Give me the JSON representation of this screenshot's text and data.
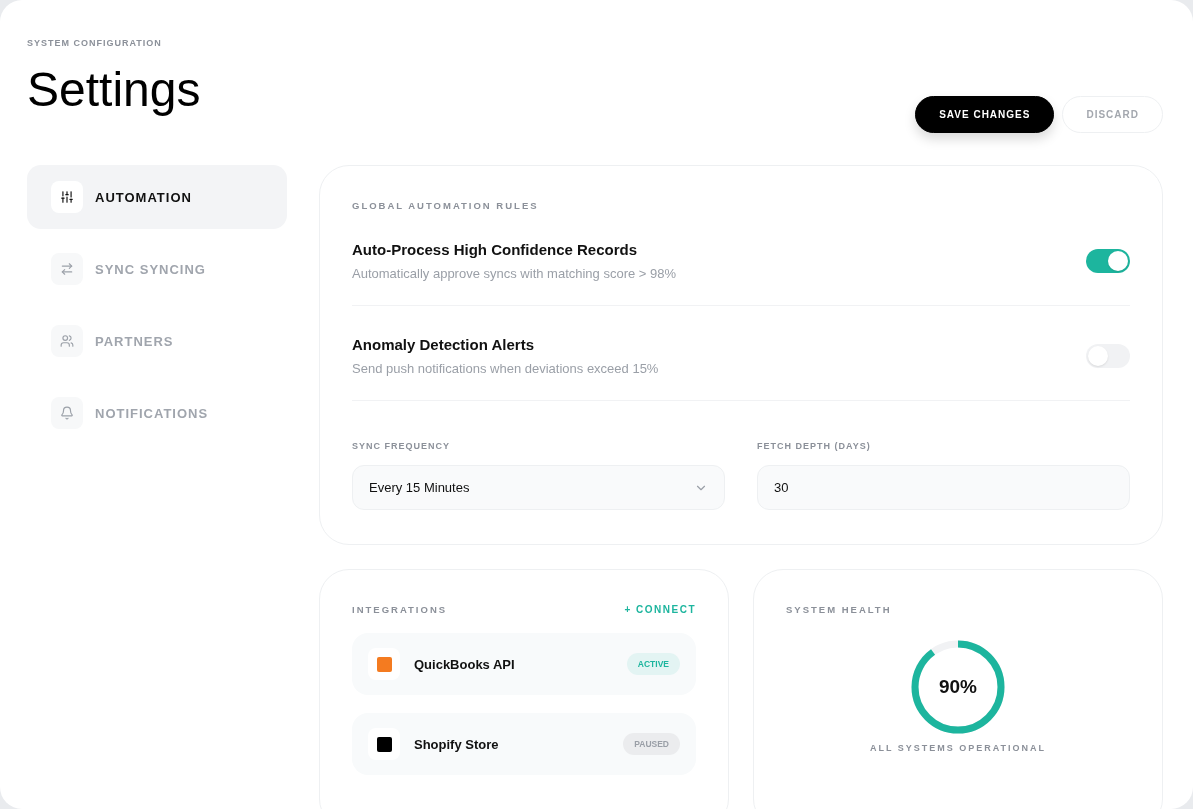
{
  "header": {
    "eyebrow": "SYSTEM CONFIGURATION",
    "title": "Settings",
    "buttons": [
      {
        "label": "SAVE CHANGES",
        "kind": "primary"
      },
      {
        "label": "DISCARD",
        "kind": "secondary"
      }
    ]
  },
  "sidebar": {
    "items": [
      {
        "label": "AUTOMATION",
        "kind": "sliders",
        "selected": true
      },
      {
        "label": "SYNC SYNCING",
        "kind": "arrows",
        "selected": false
      },
      {
        "label": "PARTNERS",
        "kind": "users",
        "selected": false
      },
      {
        "label": "NOTIFICATIONS",
        "kind": "bell",
        "selected": false
      }
    ]
  },
  "automation": {
    "title": "GLOBAL AUTOMATION RULES",
    "rules": [
      {
        "title": "Auto-Process High Confidence Records",
        "description": "Automatically approve syncs with matching score > 98%",
        "on": true
      },
      {
        "title": "Anomaly Detection Alerts",
        "description": "Send push notifications when deviations exceed 15%",
        "on": false
      }
    ],
    "fields": [
      {
        "label": "SYNC FREQUENCY",
        "kind": "select",
        "value": "Every 15 Minutes"
      },
      {
        "label": "FETCH DEPTH (DAYS)",
        "kind": "input",
        "value": "30"
      }
    ]
  },
  "integrations": {
    "title": "INTEGRATIONS",
    "action": "+ CONNECT",
    "items": [
      {
        "name": "QuickBooks API",
        "color": "#f47b20",
        "status": "ACTIVE",
        "kind": "active"
      },
      {
        "name": "Shopify Store",
        "color": "#000000",
        "status": "PAUSED",
        "kind": "paused"
      }
    ]
  },
  "health": {
    "title": "SYSTEM HEALTH",
    "level": 0.9,
    "reading": "90%",
    "status": "ALL SYSTEMS OPERATIONAL"
  }
}
